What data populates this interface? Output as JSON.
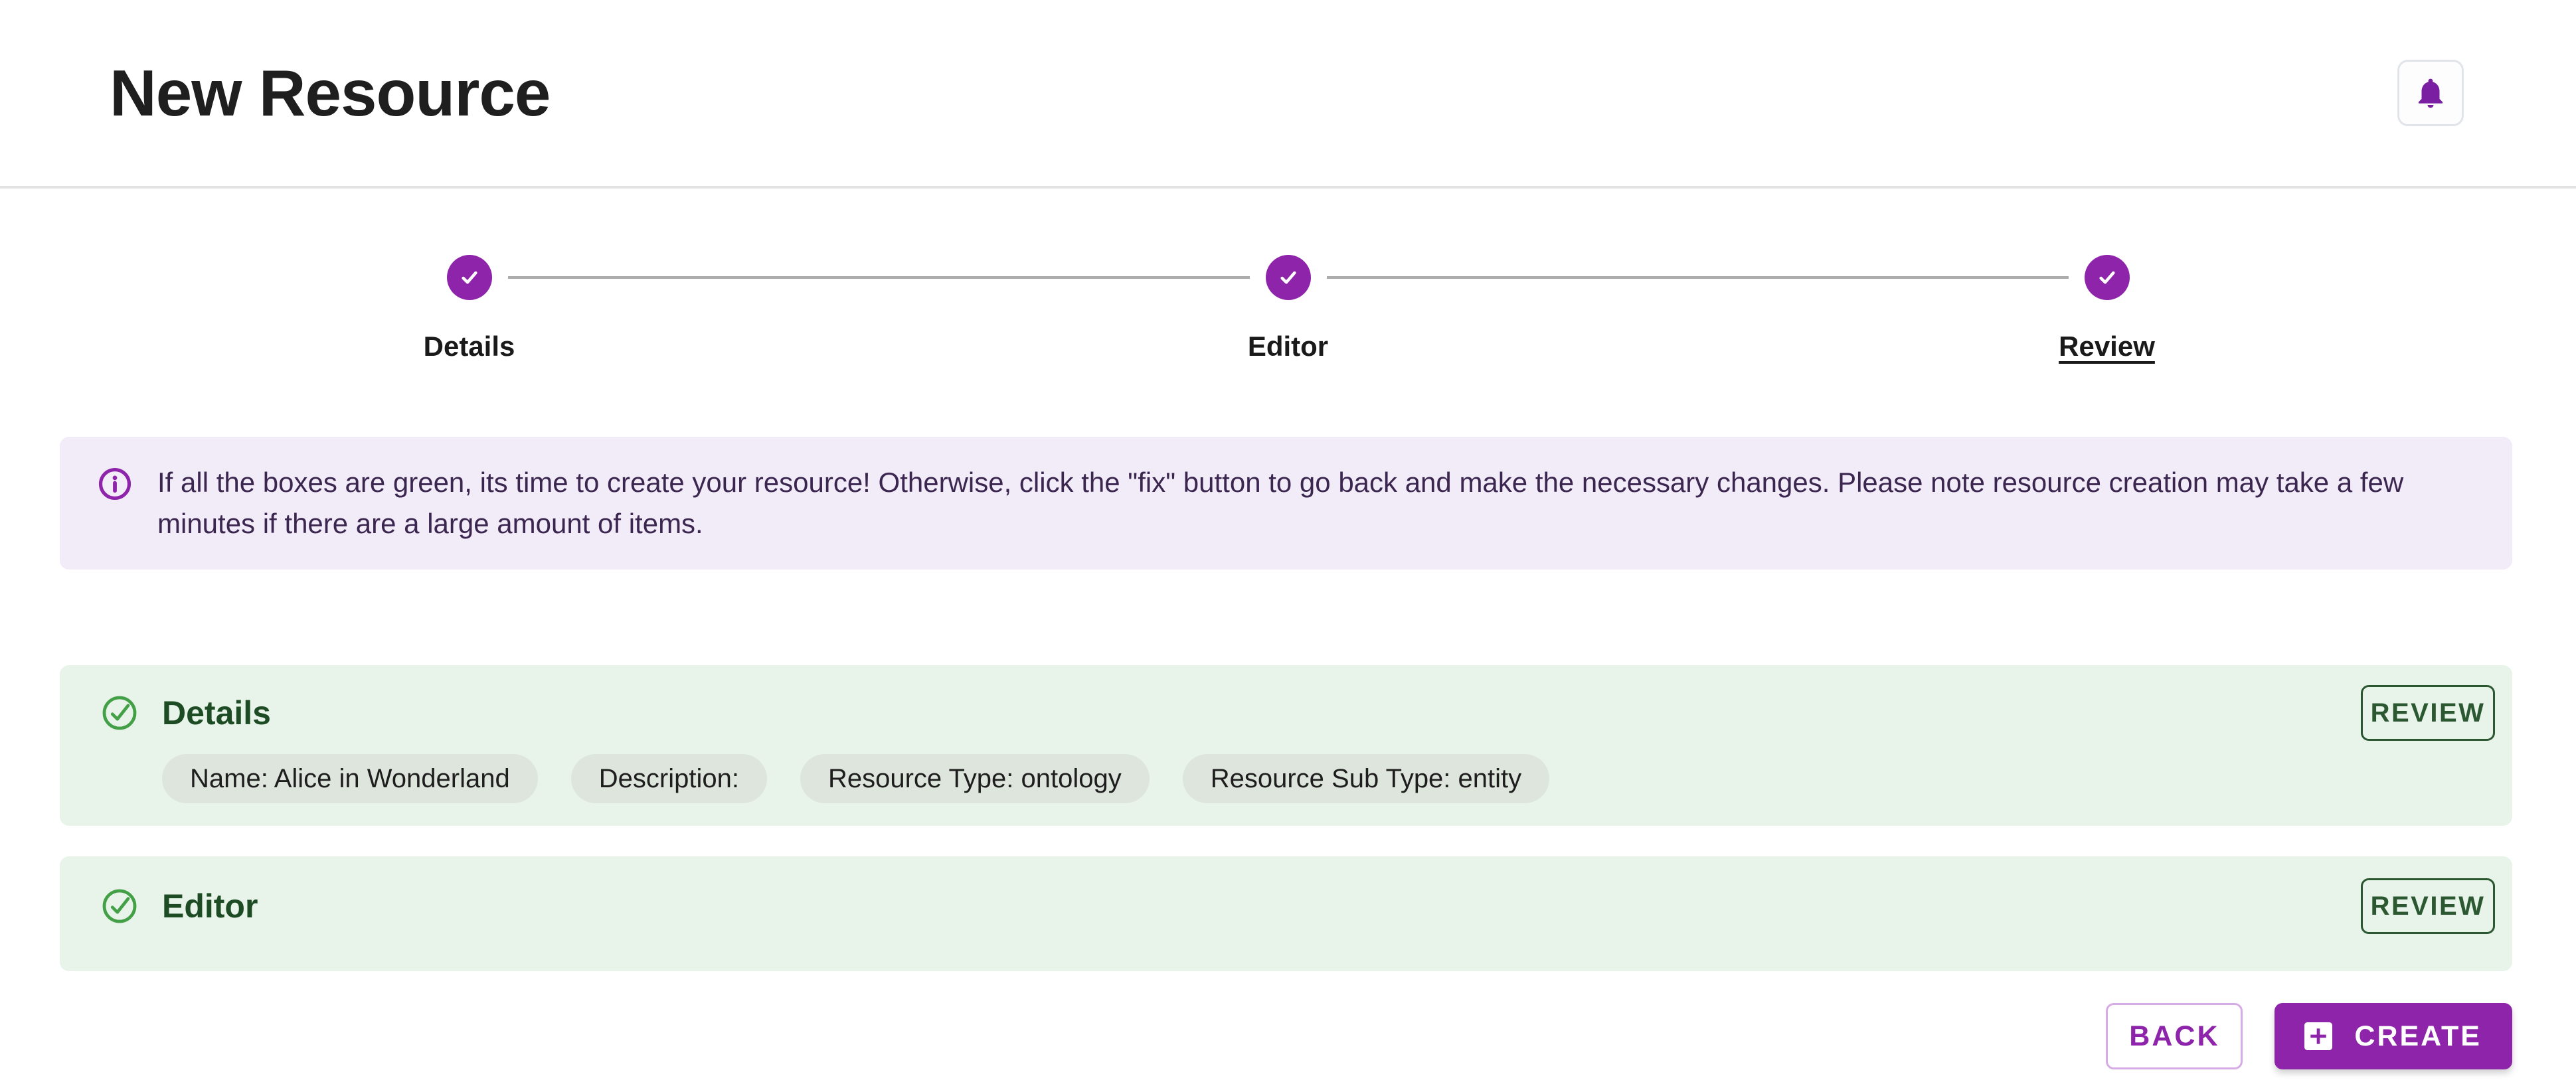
{
  "header": {
    "title": "New Resource",
    "bell_icon": "notifications-bell"
  },
  "stepper": {
    "steps": [
      {
        "label": "Details",
        "completed": true,
        "active": false
      },
      {
        "label": "Editor",
        "completed": true,
        "active": false
      },
      {
        "label": "Review",
        "completed": true,
        "active": true
      }
    ]
  },
  "info_banner": {
    "icon": "info-icon",
    "text": "If all the boxes are green, its time to create your resource! Otherwise, click the \"fix\" button to go back and make the necessary changes. Please note resource creation may take a few minutes if there are a large amount of items."
  },
  "review_sections": [
    {
      "title": "Details",
      "status_icon": "check-circle",
      "button_label": "REVIEW",
      "chips": [
        "Name: Alice in Wonderland",
        "Description:",
        "Resource Type: ontology",
        "Resource Sub Type: entity"
      ]
    },
    {
      "title": "Editor",
      "status_icon": "check-circle",
      "button_label": "REVIEW",
      "chips": []
    }
  ],
  "footer": {
    "back_label": "BACK",
    "create_label": "CREATE",
    "create_icon": "add-box"
  },
  "colors": {
    "primary_purple": "#8E24AA",
    "bell_purple": "#7B1FA2",
    "success_green": "#43A047",
    "panel_title_green": "#1D4B23",
    "review_button_green": "#2B5731",
    "panel_bg": "#E8F3E9",
    "chip_bg": "#DEE5DC",
    "banner_bg": "#F2EBF8",
    "banner_text": "#3B2650",
    "connector_gray": "#ACACAC",
    "divider_gray": "#E2E2E2"
  }
}
